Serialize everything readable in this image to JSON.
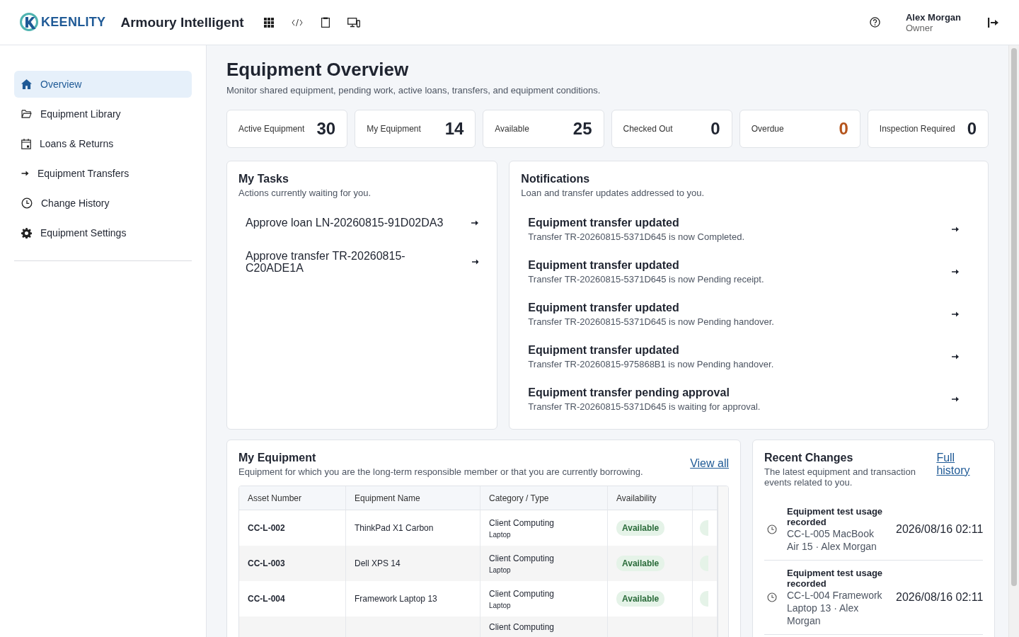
{
  "header": {
    "brand": "KEENLITY",
    "app_title": "Armoury Intelligent",
    "user": {
      "name": "Alex Morgan",
      "role": "Owner"
    }
  },
  "sidebar": {
    "items": [
      {
        "label": "Overview",
        "selected": true
      },
      {
        "label": "Equipment Library",
        "selected": false
      },
      {
        "label": "Loans & Returns",
        "selected": false
      },
      {
        "label": "Equipment Transfers",
        "selected": false
      },
      {
        "label": "Change History",
        "selected": false
      },
      {
        "label": "Equipment Settings",
        "selected": false
      }
    ]
  },
  "page": {
    "title": "Equipment Overview",
    "subtitle": "Monitor shared equipment, pending work, active loans, transfers, and equipment conditions."
  },
  "stats": [
    {
      "label": "Active Equipment",
      "value": "30",
      "alert": false
    },
    {
      "label": "My Equipment",
      "value": "14",
      "alert": false
    },
    {
      "label": "Available",
      "value": "25",
      "alert": false
    },
    {
      "label": "Checked Out",
      "value": "0",
      "alert": false
    },
    {
      "label": "Overdue",
      "value": "0",
      "alert": true
    },
    {
      "label": "Inspection Required",
      "value": "0",
      "alert": false
    }
  ],
  "tasks": {
    "title": "My Tasks",
    "subtitle": "Actions currently waiting for you.",
    "items": [
      {
        "label": "Approve loan LN-20260815-91D02DA3"
      },
      {
        "label": "Approve transfer TR-20260815-C20ADE1A"
      }
    ]
  },
  "notifications": {
    "title": "Notifications",
    "subtitle": "Loan and transfer updates addressed to you.",
    "items": [
      {
        "title": "Equipment transfer updated",
        "detail": "Transfer TR-20260815-5371D645 is now Completed."
      },
      {
        "title": "Equipment transfer updated",
        "detail": "Transfer TR-20260815-5371D645 is now Pending receipt."
      },
      {
        "title": "Equipment transfer updated",
        "detail": "Transfer TR-20260815-5371D645 is now Pending handover."
      },
      {
        "title": "Equipment transfer updated",
        "detail": "Transfer TR-20260815-975868B1 is now Pending handover."
      },
      {
        "title": "Equipment transfer pending approval",
        "detail": "Transfer TR-20260815-5371D645 is waiting for approval."
      }
    ]
  },
  "my_equipment": {
    "title": "My Equipment",
    "subtitle": "Equipment for which you are the long-term responsible member or that you are currently borrowing.",
    "link": "View all",
    "table": {
      "columns": [
        "Asset Number",
        "Equipment Name",
        "Category / Type",
        "Availability"
      ],
      "rows": [
        {
          "asset": "CC-L-002",
          "name": "ThinkPad X1 Carbon",
          "category": "Client Computing",
          "type": "Laptop",
          "availability": "Available"
        },
        {
          "asset": "CC-L-003",
          "name": "Dell XPS 14",
          "category": "Client Computing",
          "type": "Laptop",
          "availability": "Available"
        },
        {
          "asset": "CC-L-004",
          "name": "Framework Laptop 13",
          "category": "Client Computing",
          "type": "Laptop",
          "availability": "Available"
        },
        {
          "category": "Client Computing"
        }
      ]
    }
  },
  "recent_changes": {
    "title": "Recent Changes",
    "subtitle": "The latest equipment and transaction events related to you.",
    "link": "Full history",
    "items": [
      {
        "title": "Equipment test usage recorded",
        "detail": "CC-L-005 MacBook Air 15 · Alex Morgan",
        "time": "2026/08/16 02:11"
      },
      {
        "title": "Equipment test usage recorded",
        "detail": "CC-L-004 Framework Laptop 13 · Alex Morgan",
        "time": "2026/08/16 02:11"
      }
    ]
  }
}
